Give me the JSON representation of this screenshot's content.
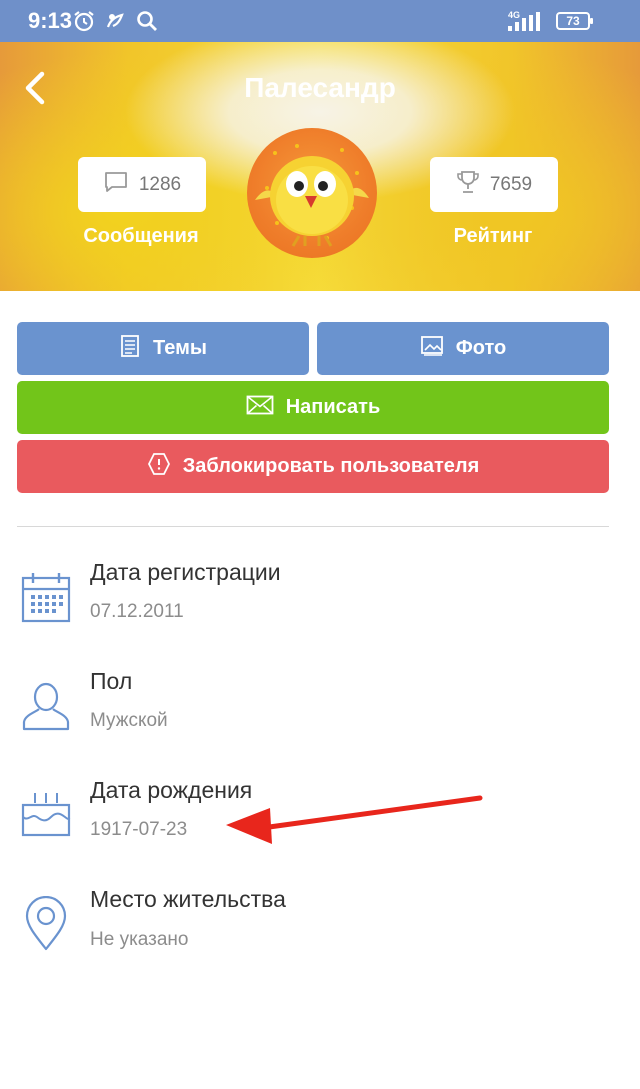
{
  "status_bar": {
    "time": "9:13",
    "network": "4G",
    "battery": "73"
  },
  "header": {
    "title": "Палесандр",
    "messages": {
      "count": "1286",
      "label": "Сообщения"
    },
    "rating": {
      "count": "7659",
      "label": "Рейтинг"
    }
  },
  "actions": {
    "topics": "Темы",
    "photo": "Фото",
    "write": "Написать",
    "block": "Заблокировать пользователя"
  },
  "info": [
    {
      "label": "Дата регистрации",
      "value": "07.12.2011",
      "icon": "calendar-icon"
    },
    {
      "label": "Пол",
      "value": "Мужской",
      "icon": "person-icon"
    },
    {
      "label": "Дата рождения",
      "value": "1917-07-23",
      "icon": "birthday-cake-icon"
    },
    {
      "label": "Место жительства",
      "value": "Не указано",
      "icon": "location-pin-icon"
    }
  ],
  "colors": {
    "statusbar": "#6f90c9",
    "blue_button": "#6a93cf",
    "green_button": "#72c51a",
    "red_button": "#e95a5e",
    "icon_blue": "#6a93cf",
    "annotation_arrow": "#e8261c"
  }
}
